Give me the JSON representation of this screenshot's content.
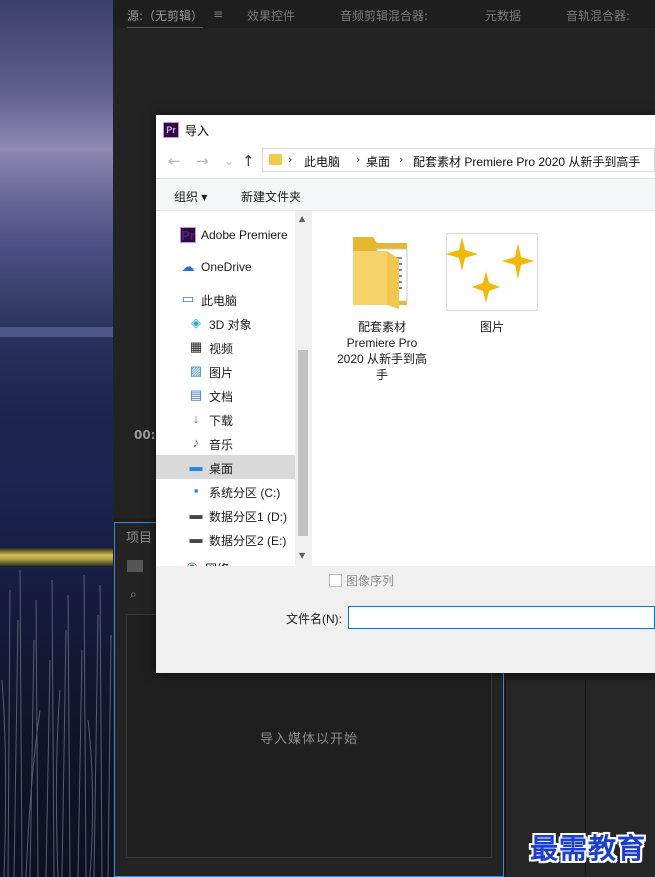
{
  "app": {
    "panels": [
      "源:（无剪辑）",
      "效果控件",
      "音频剪辑混合器:",
      "元数据",
      "音轨混合器:"
    ],
    "timecode": "00:",
    "project_tab": "项目",
    "media_hint": "导入媒体以开始"
  },
  "dialog": {
    "title": "导入",
    "app_icon": "Pr",
    "nav": {
      "back": "←",
      "forward": "→",
      "recent": "⌄",
      "up": "↑"
    },
    "breadcrumb": [
      "此电脑",
      "桌面",
      "配套素材 Premiere Pro 2020 从新手到高手"
    ],
    "toolbar": {
      "organize": "组织 ▾",
      "new_folder": "新建文件夹"
    },
    "nav_pane": [
      {
        "label": "Adobe Premiere",
        "icon": "premiere-icon",
        "glyph": "Pr"
      },
      {
        "label": "OneDrive",
        "icon": "onedrive-cloud-icon",
        "glyph": "☁"
      },
      {
        "label": "此电脑",
        "icon": "computer-icon",
        "glyph": "▭"
      },
      {
        "label": "3D 对象",
        "icon": "3d-objects-icon",
        "glyph": "◈"
      },
      {
        "label": "视频",
        "icon": "video-icon",
        "glyph": "▦"
      },
      {
        "label": "图片",
        "icon": "pictures-icon",
        "glyph": "▨"
      },
      {
        "label": "文档",
        "icon": "documents-icon",
        "glyph": "▤"
      },
      {
        "label": "下载",
        "icon": "download-arrow-icon",
        "glyph": "↓"
      },
      {
        "label": "音乐",
        "icon": "music-note-icon",
        "glyph": "♪"
      },
      {
        "label": "桌面",
        "icon": "desktop-icon",
        "glyph": "▬"
      },
      {
        "label": "系统分区 (C:)",
        "icon": "system-drive-icon",
        "glyph": "▪"
      },
      {
        "label": "数据分区1 (D:)",
        "icon": "drive-icon",
        "glyph": "▬"
      },
      {
        "label": "数据分区2 (E:)",
        "icon": "drive-icon",
        "glyph": "▬"
      },
      {
        "label": "网络",
        "icon": "network-icon",
        "glyph": "◉"
      }
    ],
    "selected_nav": "桌面",
    "files": [
      {
        "name_lines": [
          "配套素材",
          "Premiere Pro",
          "2020 从新手到高",
          "手"
        ],
        "icon": "folder-with-files-icon"
      },
      {
        "name_lines": [
          "图片"
        ],
        "icon": "sparkle-image-icon"
      }
    ],
    "image_sequence": "图像序列",
    "filename_label": "文件名(N):",
    "filename_value": ""
  },
  "watermark": "最需教育",
  "colors": {
    "accent": "#0078d7",
    "premiere_blue": "#2d8ceb",
    "folder": "#f3c948",
    "sparkle": "#f5b800",
    "watermark": "#1a3fd0"
  }
}
